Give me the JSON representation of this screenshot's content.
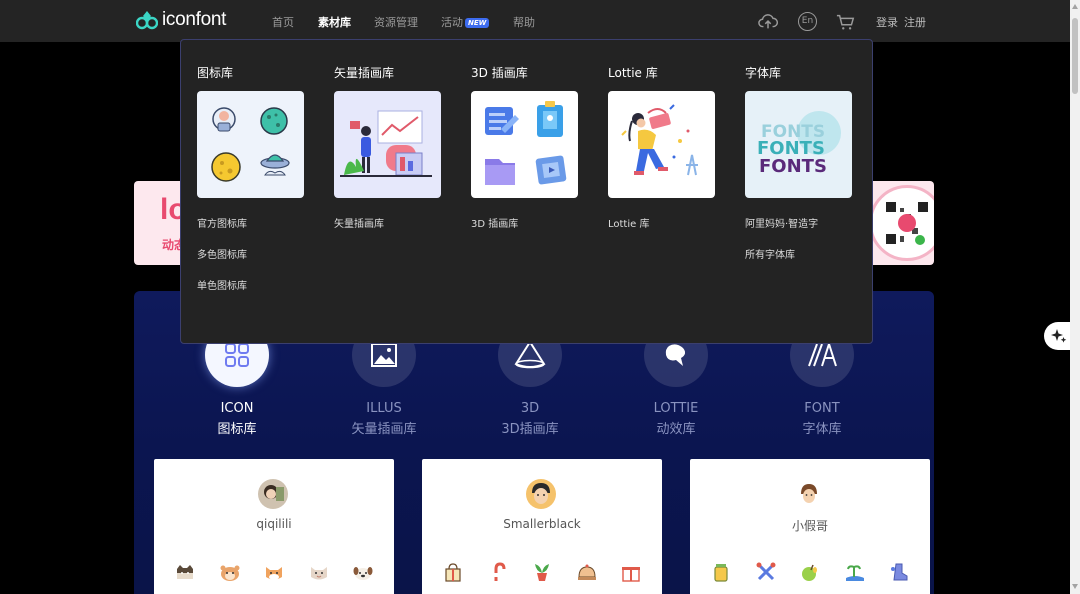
{
  "header": {
    "logo_text": "iconfont",
    "nav": [
      {
        "label": "首页",
        "active": false
      },
      {
        "label": "素材库",
        "active": true
      },
      {
        "label": "资源管理",
        "active": false
      },
      {
        "label": "活动",
        "badge": "NEW",
        "active": false
      },
      {
        "label": "帮助",
        "active": false
      }
    ],
    "lang_label": "En",
    "login_label": "登录",
    "register_label": "注册",
    "icons": [
      "upload-cloud-icon",
      "language-icon",
      "cart-icon"
    ]
  },
  "dropdown": {
    "columns": [
      {
        "title": "图标库",
        "links": [
          "官方图标库",
          "多色图标库",
          "单色图标库"
        ]
      },
      {
        "title": "矢量插画库",
        "links": [
          "矢量插画库"
        ]
      },
      {
        "title": "3D 插画库",
        "links": [
          "3D 插画库"
        ]
      },
      {
        "title": "Lottie 库",
        "links": [
          "Lottie 库"
        ]
      },
      {
        "title": "字体库",
        "links": [
          "阿里妈妈·智造字",
          "所有字体库"
        ]
      }
    ],
    "fonts_thumb_text": "FONTS"
  },
  "banner": {
    "left_text": "lo",
    "left_sub": "动态"
  },
  "categories": [
    {
      "en": "ICON",
      "cn": "图标库",
      "active": true
    },
    {
      "en": "ILLUS",
      "cn": "矢量插画库",
      "active": false
    },
    {
      "en": "3D",
      "cn": "3D插画库",
      "active": false
    },
    {
      "en": "LOTTIE",
      "cn": "动效库",
      "active": false
    },
    {
      "en": "FONT",
      "cn": "字体库",
      "active": false
    }
  ],
  "cards": [
    {
      "name": "qiqilili"
    },
    {
      "name": "Smallerblack"
    },
    {
      "name": "小假哥"
    }
  ],
  "colors": {
    "nav_bg": "#242424",
    "dropdown_bg": "#232323",
    "showcase_bg": "#0f1a5c",
    "accent_blue": "#3d6cf0",
    "banner_pink": "#e84a6f"
  }
}
